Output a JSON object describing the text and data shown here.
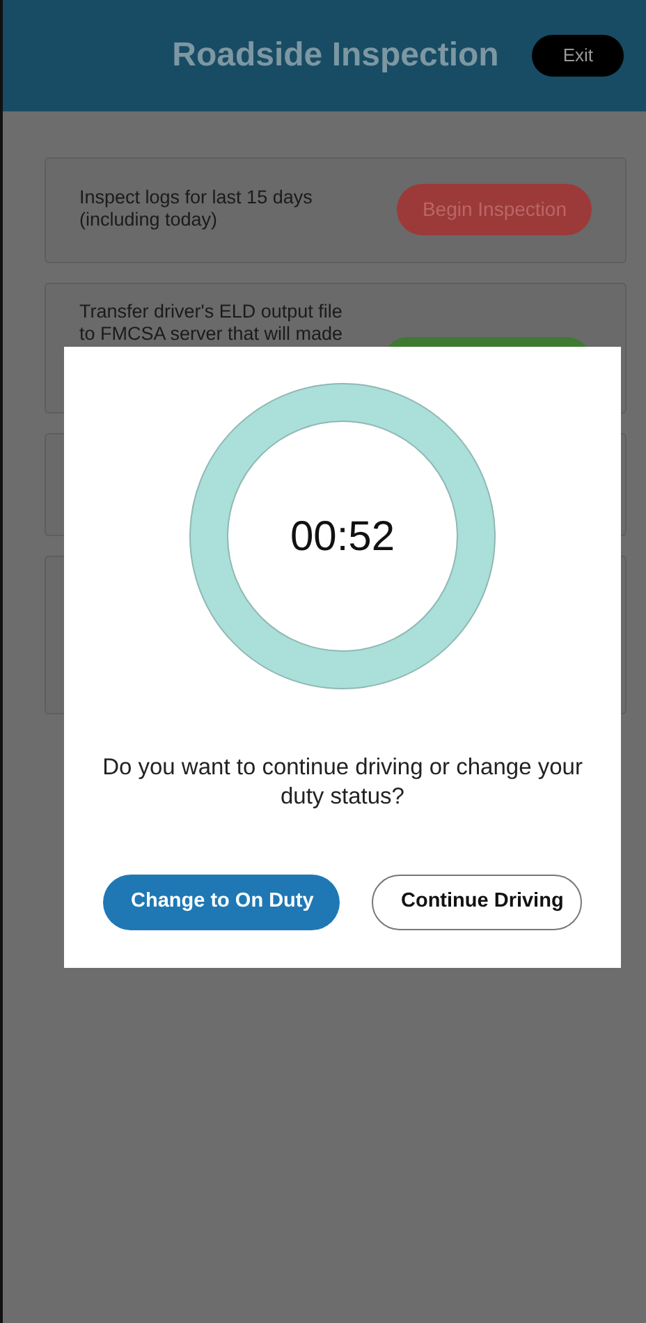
{
  "header": {
    "title": "Roadside Inspection",
    "exit_button": "Exit"
  },
  "cards": [
    {
      "text": "Inspect logs for last 15 days (including today)",
      "button": "Begin Inspection",
      "kind": "danger"
    },
    {
      "text": "Transfer driver's ELD output file to FMCSA server that will made",
      "kind": "success"
    },
    {
      "kind": "blank"
    },
    {
      "kind": "blank"
    }
  ],
  "dialog": {
    "timer": "00:52",
    "question": "Do you want to continue driving or change your duty status?",
    "buttons": [
      {
        "label": "Change to On Duty",
        "kind": "primary"
      },
      {
        "label": "Continue Driving",
        "kind": "outline"
      }
    ]
  }
}
